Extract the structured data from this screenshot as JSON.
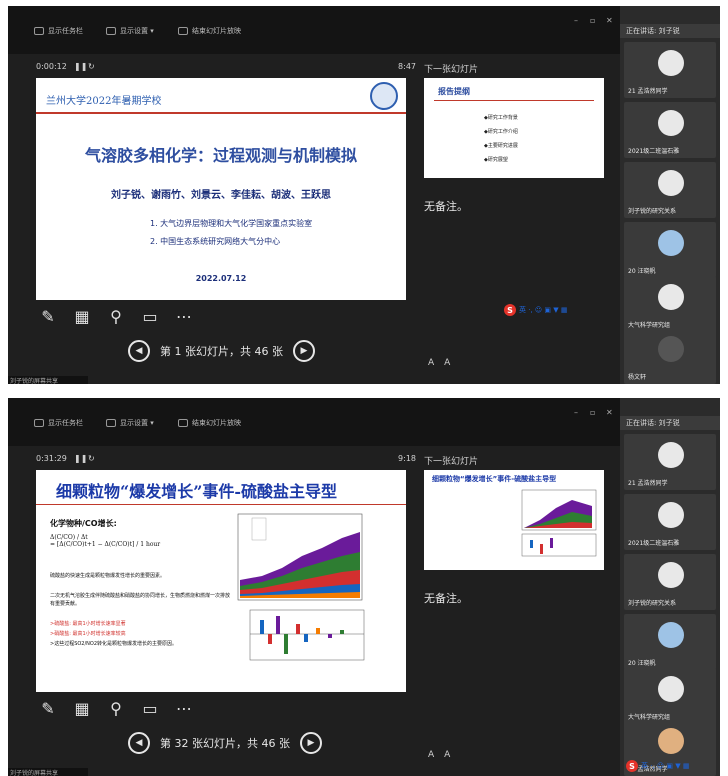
{
  "toolbar": {
    "show_taskbar": "显示任务栏",
    "display_settings": "显示设置 ▾",
    "end_slideshow": "结束幻灯片放映",
    "minimize": "–",
    "restore": "▫",
    "close": "✕"
  },
  "sidebar": {
    "speaker_label": "正在讲话: 刘子锐",
    "participants_1": [
      "21 孟浩然同学",
      "2021级二班温石雅",
      "刘子锐的研究关系",
      "20 汪晓帆",
      "大气科学研究组",
      "杨文轩"
    ],
    "participants_2": [
      "21 孟浩然同学",
      "2021级二班温石雅",
      "刘子锐的研究关系",
      "20 汪晓帆",
      "大气科学研究组",
      "21 孟浩然同学"
    ]
  },
  "panel": {
    "next_label": "下一张幻灯片",
    "notes": "无备注。",
    "font_up": "A",
    "font_down": "A"
  },
  "ime": {
    "text": "英 ·, ☺ ▣ ▼ ▦"
  },
  "bottom_text": "刘子锐的屏幕共享",
  "shot1": {
    "time": "0:00:12",
    "elapsed": "8:47",
    "nav_label": "第 1 张幻灯片，共 46 张",
    "slide": {
      "university": "兰州大学2022年暑期学校",
      "title": "气溶胶多相化学：过程观测与机制模拟",
      "authors": "刘子锐、谢雨竹、刘景云、李佳耘、胡波、王跃思",
      "affiliation_1": "1. 大气边界层物理和大气化学国家重点实验室",
      "affiliation_2": "2. 中国生态系统研究网络大气分中心",
      "date": "2022.07.12"
    },
    "next_slide": {
      "title": "报告提纲",
      "items": [
        "◆研究工作背景",
        "◆研究工作介绍",
        "◆主要研究进展",
        "◆研究展望"
      ]
    }
  },
  "shot2": {
    "time": "0:31:29",
    "elapsed": "9:18",
    "nav_label": "第 32 张幻灯片，共 46 张",
    "slide": {
      "title": "细颗粒物“爆发增长”事件-硫酸盐主导型",
      "subtitle": "化学物种/CO增长:",
      "formula_left": "Δ(C/CO) / Δt",
      "formula_right": "= [Δ(C/CO)t+1 − Δ(C/CO)t] / 1 hour",
      "para1": "硫酸盐的快速生成是颗粒物爆发性增长的重要因素。",
      "para2": "二次无机气溶胶生成伴随硫酸盐和硝酸盐的协同增长，生物质燃烧和燃煤一次排放有重要贡献。",
      "bullet1": ">硫酸盐: 最高1小时增长速率显著",
      "bullet2": ">硝酸盐: 最高1小时增长速率较高",
      "bullet3": ">这些过程SO2/NO2转化是颗粒物爆发增长的主要原因。"
    },
    "next_slide": {
      "title": "细颗粒物“爆发增长”事件-硫酸盐主导型"
    }
  }
}
